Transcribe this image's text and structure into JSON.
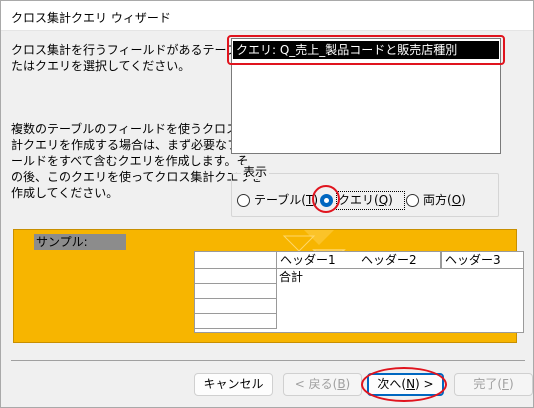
{
  "window": {
    "title": "クロス集計クエリ ウィザード"
  },
  "description": {
    "top_lines": [
      "クロス集計を行うフィールドがあるテーブルま",
      "たはクエリを選択してください。"
    ],
    "bottom_lines": [
      "複数のテーブルのフィールドを使うクロス集",
      "計クエリを作成する場合は、まず必要なフィ",
      "ールドをすべて含むクエリを作成します。そ",
      "の後、このクエリを使ってクロス集計クエリを",
      "作成してください。"
    ]
  },
  "listbox": {
    "items": [
      "クエリ: Q_売上_製品コードと販売店種別"
    ],
    "selected_index": 0
  },
  "view_group": {
    "label": "表示",
    "options": [
      {
        "label": "テーブル(",
        "key": "T",
        "suffix": ")",
        "checked": false
      },
      {
        "label": "クエリ(",
        "key": "Q",
        "suffix": ")",
        "checked": true
      },
      {
        "label": "両方(",
        "key": "O",
        "suffix": ")",
        "checked": false
      }
    ]
  },
  "sample": {
    "label": "サンプル:",
    "headers": [
      "ヘッダー1",
      "ヘッダー2",
      "ヘッダー3"
    ],
    "total_label": "合計"
  },
  "buttons": {
    "cancel": "キャンセル",
    "back": {
      "label": "< 戻る(",
      "key": "B",
      "suffix": ")"
    },
    "next": {
      "label": "次へ(",
      "key": "N",
      "suffix": ") >"
    },
    "finish": {
      "label": "完了(",
      "key": "F",
      "suffix": ")"
    }
  },
  "colors": {
    "accent": "#0067c0",
    "highlight_annotation": "#e0141e",
    "sample_background": "#f7b500"
  }
}
